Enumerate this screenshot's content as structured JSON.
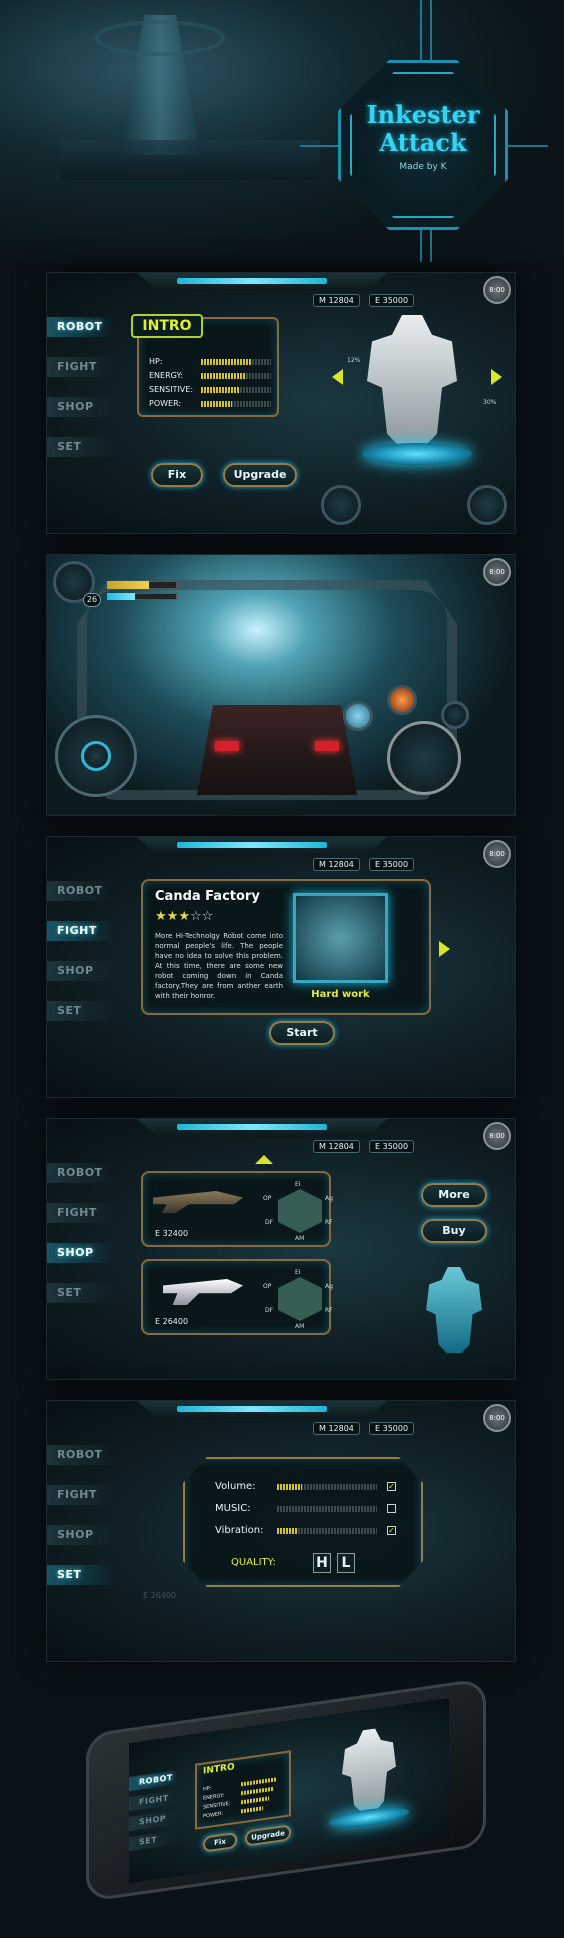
{
  "logo": {
    "title_line1": "Inkester",
    "title_line2": "Attack",
    "subtitle": "Made by K"
  },
  "currency": {
    "m_value": "M  12804",
    "e_value": "E  35000"
  },
  "clock": "8:00",
  "nav": {
    "robot": "ROBOT",
    "fight": "FIGHT",
    "shop": "SHOP",
    "set": "SET"
  },
  "robot_screen": {
    "intro_title": "INTRO",
    "stats": [
      {
        "label": "HP:",
        "level": 0.72
      },
      {
        "label": "ENERGY:",
        "level": 0.65
      },
      {
        "label": "SENSITIVE:",
        "level": 0.55
      },
      {
        "label": "POWER:",
        "level": 0.45
      }
    ],
    "fix_label": "Fix",
    "upgrade_label": "Upgrade",
    "callout_left_pct": "12%",
    "callout_right_pct": "30%"
  },
  "battle_screen": {
    "level_badge": "26",
    "hp_level": 0.6,
    "energy_level": 0.4
  },
  "fight_screen": {
    "mission_title": "Canda  Factory",
    "stars_filled": 3,
    "stars_total": 5,
    "star_filled_glyph": "★",
    "star_empty_glyph": "☆",
    "description": "More Hi-Technolgy Robot come into normal people's life. The people have no idea to solve this problem. At this time, there are some new robot coming down in Canda factory.They are from anther earth with their honror.",
    "difficulty": "Hard work",
    "start_label": "Start"
  },
  "shop_screen": {
    "weapons": [
      {
        "price": "E  32400",
        "stat_labels": [
          "EI",
          "OP",
          "Ag",
          "DF",
          "RF",
          "AM"
        ]
      },
      {
        "price": "E  26400",
        "stat_labels": [
          "EI",
          "OP",
          "Ag",
          "DF",
          "RF",
          "AM"
        ]
      }
    ],
    "more_label": "More",
    "buy_label": "Buy"
  },
  "settings_screen": {
    "volume_label": "Volume:",
    "music_label": "MUSIC:",
    "vibration_label": "Vibration:",
    "volume_checked": "✓",
    "music_checked": "",
    "vibration_checked": "✓",
    "volume_level": 0.25,
    "music_level": 0.0,
    "vibration_level": 0.2,
    "quality_label": "QUALITY:",
    "quality_high": "H",
    "quality_low": "L",
    "bg_price": "E  26400"
  },
  "colors": {
    "accent": "#35d4f3",
    "gold": "#8a6a3a",
    "bar": "#d8c22c"
  }
}
